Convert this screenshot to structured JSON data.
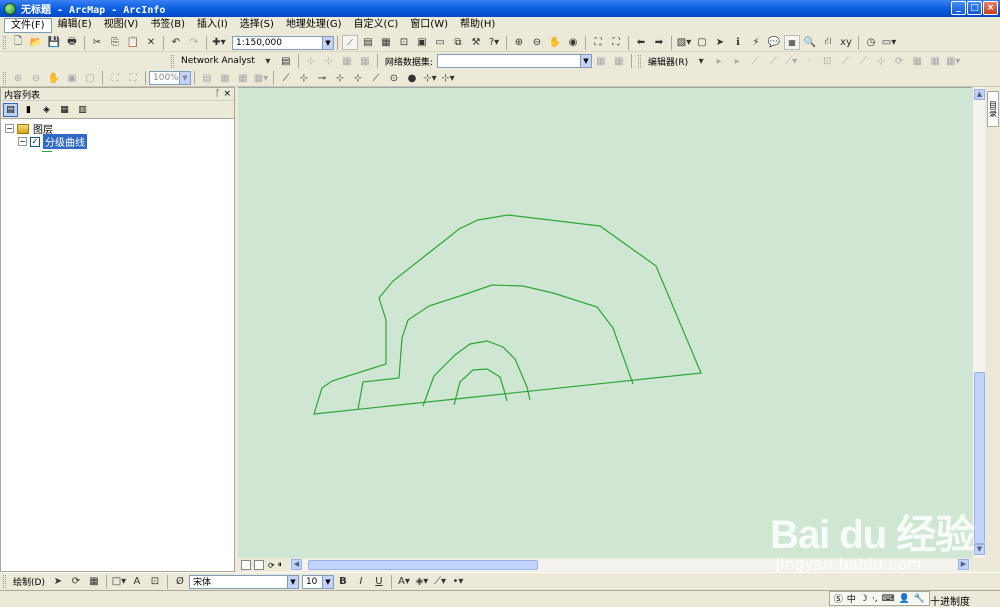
{
  "window": {
    "title": "无标题 - ArcMap - ArcInfo",
    "minimize": "_",
    "maximize": "□",
    "close": "×"
  },
  "menu": [
    "文件(F)",
    "编辑(E)",
    "视图(V)",
    "书签(B)",
    "插入(I)",
    "选择(S)",
    "地理处理(G)",
    "自定义(C)",
    "窗口(W)",
    "帮助(H)"
  ],
  "toolbar": {
    "scale_value": "1:150,000",
    "network_analyst_label": "Network Analyst",
    "network_dataset_label": "网络数据集:",
    "editor_label": "编辑器(R)",
    "zoom_percent": "100%"
  },
  "toc": {
    "title": "内容列表",
    "pin": "📌",
    "close": "×",
    "root_label": "图层",
    "layer_label": "分级曲线",
    "layer_checked": true
  },
  "drawing_toolbar": {
    "draw_label": "绘制(D)",
    "font_name": "宋体",
    "font_size": "10",
    "bold": "B",
    "italic": "I",
    "underline": "U",
    "text_tool": "A"
  },
  "right_dock": {
    "tab_label": "目录"
  },
  "status": {
    "ime_lang": "中",
    "text": "十进制度"
  },
  "watermark": {
    "logo": "Bai du 经验",
    "url": "jingyan.baidu.com"
  },
  "colors": {
    "map_background": "#cfe7d2",
    "contour_line": "#2ea53a",
    "title_bar": "#0a5fe0",
    "selection": "#316ac5"
  }
}
